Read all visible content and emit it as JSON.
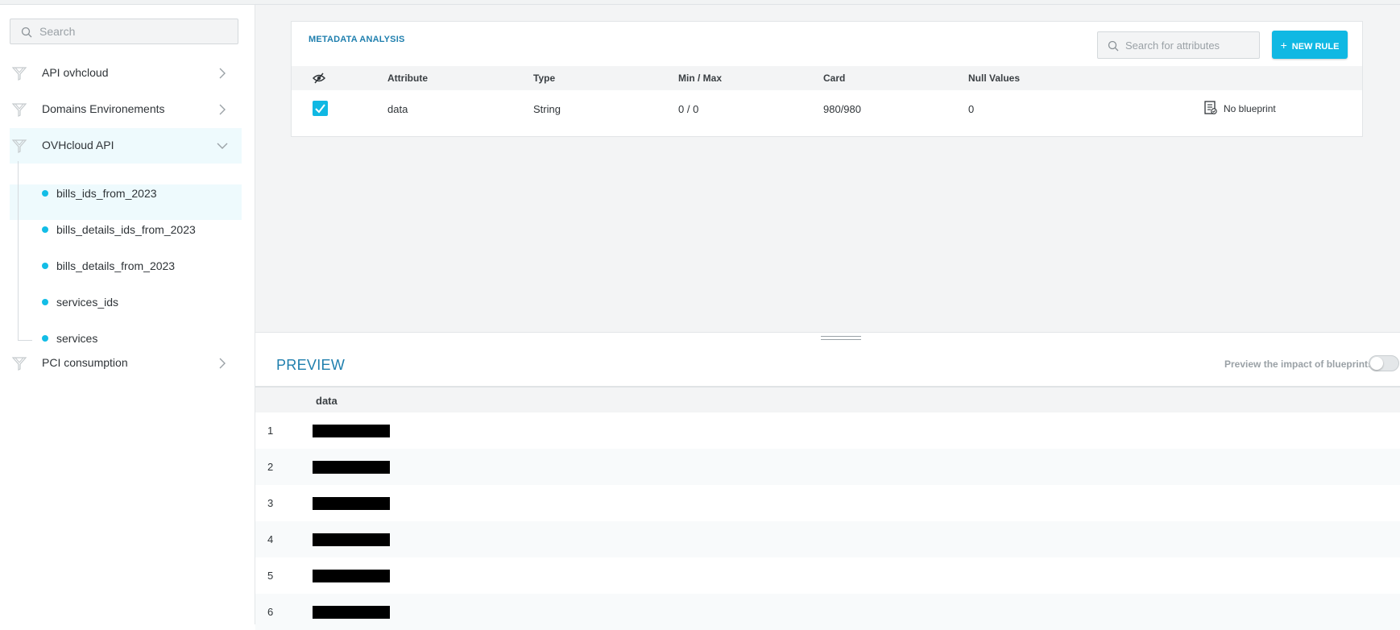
{
  "sidebar": {
    "search": {
      "placeholder": "Search"
    },
    "items": [
      {
        "label": "API ovhcloud",
        "expanded": false
      },
      {
        "label": "Domains Environements",
        "expanded": false
      },
      {
        "label": "OVHcloud API",
        "expanded": true,
        "children": [
          {
            "label": "bills_ids_from_2023",
            "selected": true
          },
          {
            "label": "bills_details_ids_from_2023"
          },
          {
            "label": "bills_details_from_2023"
          },
          {
            "label": "services_ids"
          },
          {
            "label": "services"
          }
        ]
      },
      {
        "label": "PCI consumption",
        "expanded": false
      }
    ]
  },
  "metadata": {
    "title": "METADATA ANALYSIS",
    "search_placeholder": "Search for attributes",
    "new_rule_label": "NEW RULE",
    "columns": [
      "Attribute",
      "Type",
      "Min / Max",
      "Card",
      "Null Values"
    ],
    "rows": [
      {
        "checked": true,
        "attribute": "data",
        "type": "String",
        "minmax": "0 / 0",
        "card": "980/980",
        "nulls": "0",
        "blueprint": "No blueprint"
      }
    ]
  },
  "preview": {
    "title": "PREVIEW",
    "impact_label": "Preview the impact of blueprints",
    "impact_enabled": false,
    "column": "data",
    "rows": [
      "1",
      "2",
      "3",
      "4",
      "5",
      "6"
    ]
  },
  "colors": {
    "accent": "#10b8e3",
    "title_blue": "#1f7fae",
    "selected_bg": "#eefafd"
  },
  "icons": {
    "tree_node": "funnel-icon",
    "chevron": "chevron-icon",
    "search": "search-icon",
    "visibility": "eye-slash-icon",
    "blueprint": "blueprint-icon"
  }
}
